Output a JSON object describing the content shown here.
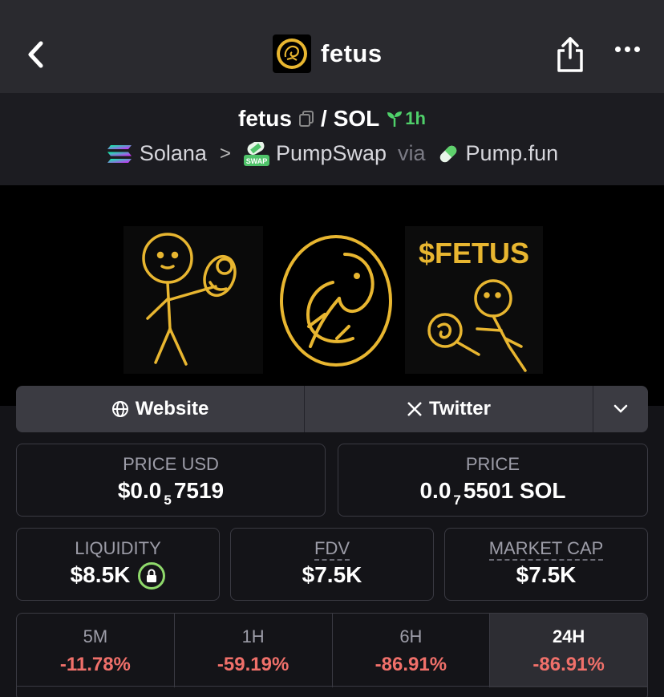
{
  "header": {
    "title": "fetus",
    "back_icon": "chevron-left-icon",
    "share_icon": "share-icon",
    "more_icon": "more-horizontal-icon"
  },
  "pair": {
    "base": "fetus",
    "quote": "SOL",
    "separator": "/",
    "age": "1h",
    "chain": "Solana",
    "dex": "PumpSwap",
    "via": "via",
    "launchpad": "Pump.fun"
  },
  "links": {
    "website": "Website",
    "twitter": "Twitter"
  },
  "price_usd": {
    "label": "PRICE USD",
    "prefix": "$0.0",
    "zeros": "5",
    "digits": "7519"
  },
  "price_native": {
    "label": "PRICE",
    "prefix": "0.0",
    "zeros": "7",
    "digits": "5501 SOL"
  },
  "liquidity": {
    "label": "LIQUIDITY",
    "value": "$8.5K"
  },
  "fdv": {
    "label": "FDV",
    "value": "$7.5K"
  },
  "market_cap": {
    "label": "MARKET CAP",
    "value": "$7.5K"
  },
  "banner": {
    "text": "$FETUS"
  },
  "performance": [
    {
      "label": "5M",
      "value": "-11.78%"
    },
    {
      "label": "1H",
      "value": "-59.19%"
    },
    {
      "label": "6H",
      "value": "-86.91%"
    },
    {
      "label": "24H",
      "value": "-86.91%"
    }
  ],
  "colors": {
    "accent_green": "#4fd06a",
    "negative_red": "#f0706a",
    "banner_gold": "#e8b630"
  }
}
